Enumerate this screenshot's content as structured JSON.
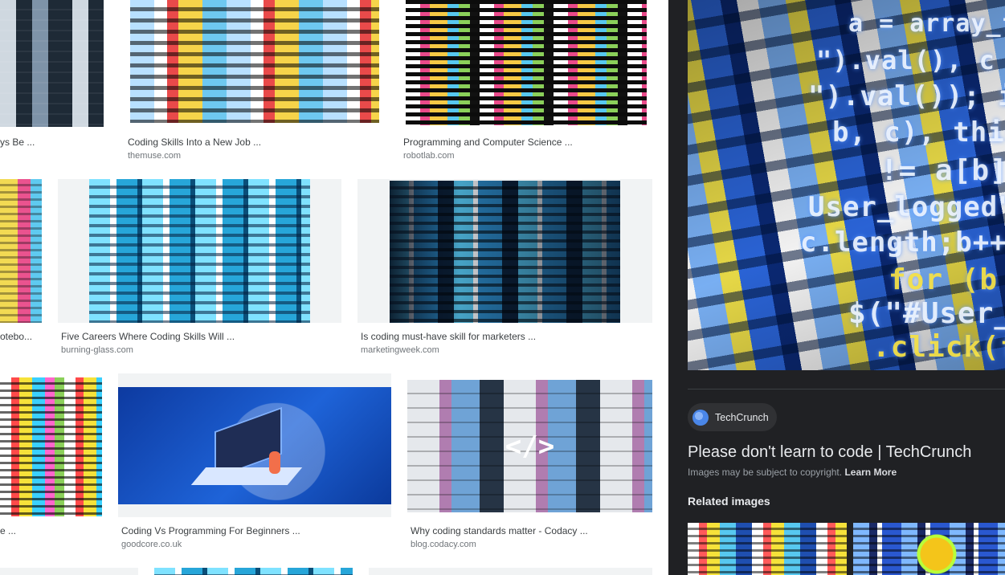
{
  "results": {
    "row1": [
      {
        "caption": "ys Be ...",
        "domain": ""
      },
      {
        "caption": "Coding Skills Into a New Job ...",
        "domain": "themuse.com"
      },
      {
        "caption": "Programming and Computer Science ...",
        "domain": "robotlab.com"
      }
    ],
    "row2": [
      {
        "caption": "otebo...",
        "domain": ""
      },
      {
        "caption": "Five Careers Where Coding Skills Will ...",
        "domain": "burning-glass.com"
      },
      {
        "caption": "Is coding must-have skill for marketers ...",
        "domain": "marketingweek.com"
      }
    ],
    "row3": [
      {
        "caption": "e ...",
        "domain": ""
      },
      {
        "caption": "Coding Vs Programming For Beginners ...",
        "domain": "goodcore.co.uk"
      },
      {
        "caption": "Why coding standards matter - Codacy ...",
        "domain": "blog.codacy.com"
      }
    ],
    "thumb_text": {
      "codacy_symbol": "</>"
    }
  },
  "preview": {
    "hero_lines": [
      "a = array_fro",
      "\").val(), c = us",
      "\").val()); if (c",
      "b, c), this.trig",
      "!= a[b] &",
      "User_logged\").va",
      "c.length;b++) {",
      "for (b =",
      "$(\"#User_log",
      ".click(functio"
    ],
    "source_name": "TechCrunch",
    "source_icon": "globe-icon",
    "title": "Please don't learn to code | TechCrunch",
    "copyright_text": "Images may be subject to copyright.",
    "learn_more": "Learn More",
    "related_heading": "Related images"
  },
  "colors": {
    "panel_bg": "#202124",
    "chip_bg": "#303134",
    "caption_text": "#3c4043",
    "domain_text": "#70757a"
  }
}
